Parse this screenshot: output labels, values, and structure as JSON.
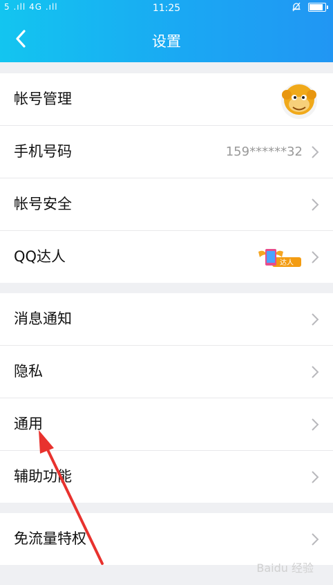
{
  "status_bar": {
    "signal": "5 .ıll 4G .ıll",
    "time": "11:25"
  },
  "header": {
    "title": "设置"
  },
  "groups": [
    {
      "rows": [
        {
          "label": "帐号管理",
          "trailing": "avatar"
        },
        {
          "label": "手机号码",
          "value": "159******32"
        },
        {
          "label": "帐号安全"
        },
        {
          "label": "QQ达人",
          "badge_text": "达人"
        }
      ]
    },
    {
      "rows": [
        {
          "label": "消息通知"
        },
        {
          "label": "隐私"
        },
        {
          "label": "通用"
        },
        {
          "label": "辅助功能"
        }
      ]
    },
    {
      "rows": [
        {
          "label": "免流量特权"
        }
      ]
    }
  ],
  "watermark": "Baidu 经验",
  "colors": {
    "header_start": "#13c5f0",
    "header_end": "#2196f3",
    "annotation_arrow": "#e8322e",
    "background": "#eff0f3"
  },
  "icons": [
    "back-arrow-icon",
    "chevron-right-icon",
    "avatar-icon",
    "qq-daren-badge-icon",
    "annotation-arrow-icon"
  ]
}
